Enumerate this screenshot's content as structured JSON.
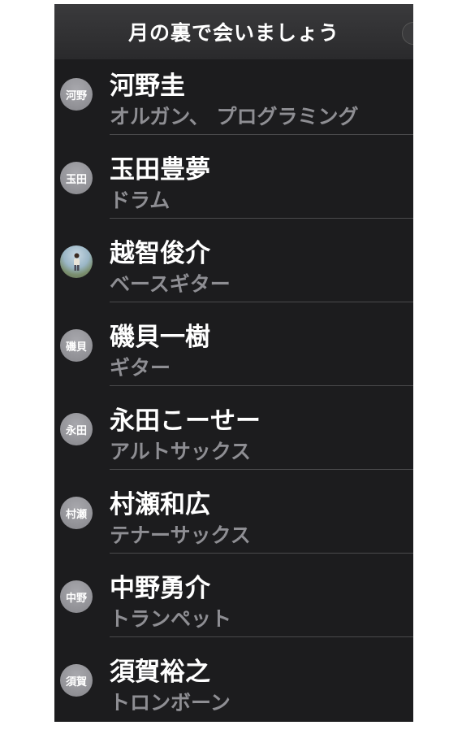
{
  "header": {
    "title": "月の裏で会いましょう"
  },
  "members": [
    {
      "name": "河野圭",
      "role": "オルガン、 プログラミング",
      "avatar": "河野",
      "avatar_type": "initials"
    },
    {
      "name": "玉田豊夢",
      "role": "ドラム",
      "avatar": "玉田",
      "avatar_type": "initials"
    },
    {
      "name": "越智俊介",
      "role": "ベースギター",
      "avatar": "",
      "avatar_type": "photo"
    },
    {
      "name": "磯貝一樹",
      "role": "ギター",
      "avatar": "磯貝",
      "avatar_type": "initials"
    },
    {
      "name": "永田こーせー",
      "role": "アルトサックス",
      "avatar": "永田",
      "avatar_type": "initials"
    },
    {
      "name": "村瀬和広",
      "role": "テナーサックス",
      "avatar": "村瀬",
      "avatar_type": "initials"
    },
    {
      "name": "中野勇介",
      "role": "トランペット",
      "avatar": "中野",
      "avatar_type": "initials"
    },
    {
      "name": "須賀裕之",
      "role": "トロンボーン",
      "avatar": "須賀",
      "avatar_type": "initials"
    }
  ]
}
